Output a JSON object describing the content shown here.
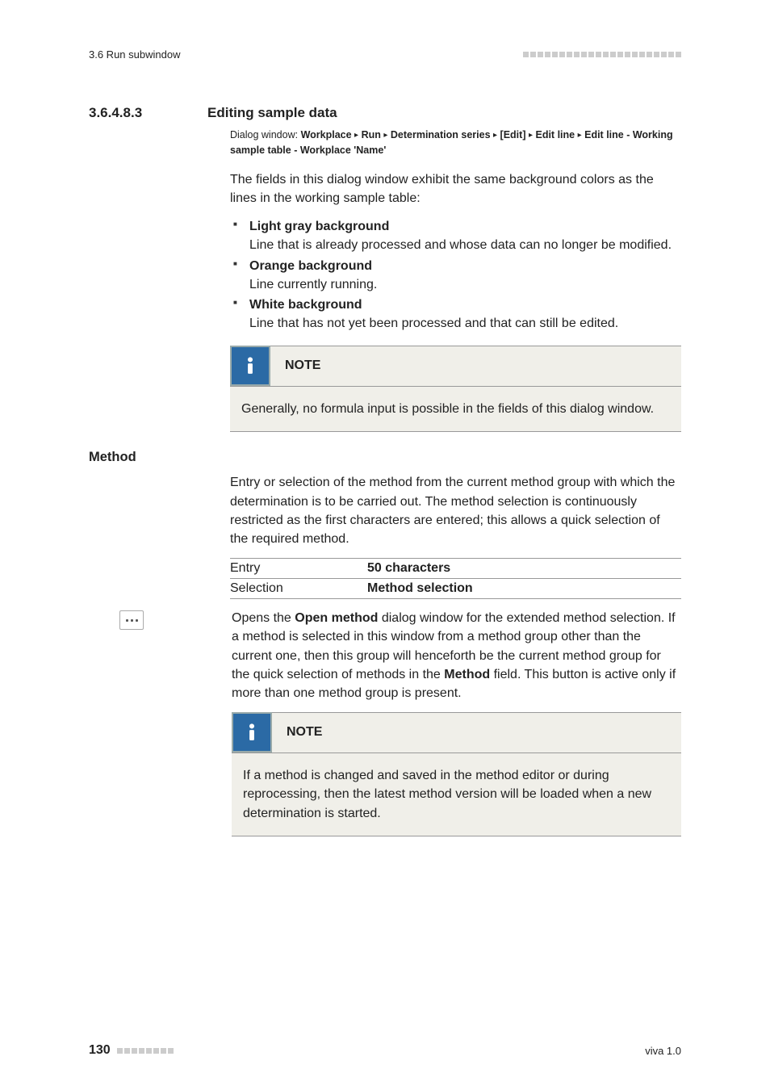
{
  "header": {
    "left": "3.6 Run subwindow"
  },
  "section": {
    "number": "3.6.4.8.3",
    "title": "Editing sample data"
  },
  "breadcrumb": {
    "prefix": "Dialog window:",
    "parts": [
      "Workplace",
      "Run",
      "Determination series",
      "[Edit]",
      "Edit line",
      "Edit line - Working sample table - Workplace 'Name'"
    ]
  },
  "intro": "The fields in this dialog window exhibit the same background colors as the lines in the working sample table:",
  "bg_items": [
    {
      "head": "Light gray background",
      "body": "Line that is already processed and whose data can no longer be modified."
    },
    {
      "head": "Orange background",
      "body": "Line currently running."
    },
    {
      "head": "White background",
      "body": "Line that has not yet been processed and that can still be edited."
    }
  ],
  "note1": {
    "title": "NOTE",
    "body": "Generally, no formula input is possible in the fields of this dialog window."
  },
  "method": {
    "heading": "Method",
    "desc": "Entry or selection of the method from the current method group with which the determination is to be carried out. The method selection is continuously restricted as the first characters are entered; this allows a quick selection of the required method.",
    "rows": [
      {
        "k": "Entry",
        "v": "50 characters"
      },
      {
        "k": "Selection",
        "v": "Method selection"
      }
    ]
  },
  "open_method": {
    "pre": "Opens the ",
    "bold1": "Open method",
    "mid": " dialog window for the extended method selection. If a method is selected in this window from a method group other than the current one, then this group will henceforth be the current method group for the quick selection of methods in the ",
    "bold2": "Method",
    "post": " field. This button is active only if more than one method group is present."
  },
  "note2": {
    "title": "NOTE",
    "body": "If a method is changed and saved in the method editor or during reprocessing, then the latest method version will be loaded when a new determination is started."
  },
  "footer": {
    "page": "130",
    "right": "viva 1.0"
  }
}
